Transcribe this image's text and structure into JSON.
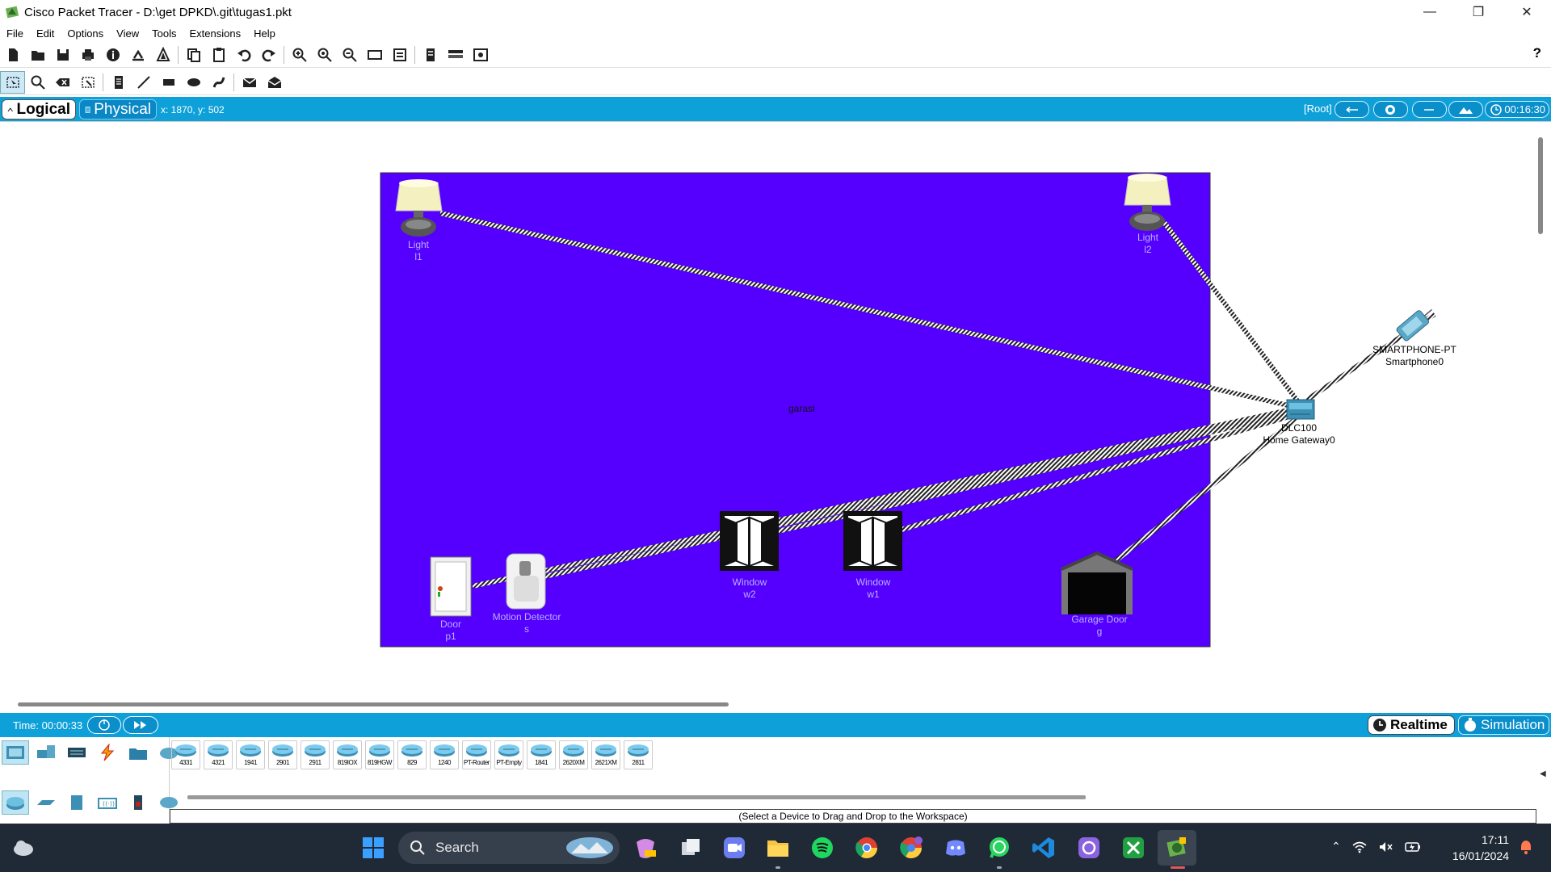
{
  "window": {
    "title": "Cisco Packet Tracer - D:\\get DPKD\\.git\\tugas1.pkt",
    "controls": [
      "minimize",
      "restore",
      "close"
    ]
  },
  "menu": [
    "File",
    "Edit",
    "Options",
    "View",
    "Tools",
    "Extensions",
    "Help"
  ],
  "toolbar": {
    "main_icons": [
      "new-file-icon",
      "open-folder-icon",
      "save-icon",
      "print-icon",
      "info-icon",
      "activity-wizard-icon",
      "network-info-icon",
      "copy-icon",
      "paste-icon",
      "undo-icon",
      "redo-icon",
      "zoom-in-icon",
      "zoom-reset-icon",
      "zoom-out-icon",
      "drawing-palette-icon",
      "custom-device-dialog-icon",
      "viewport-icon",
      "cluster-icon",
      "pdu-list-icon"
    ],
    "help_label": "?",
    "edit_icons": [
      "select-icon",
      "inspect-icon",
      "delete-icon",
      "resize-icon",
      "note-icon",
      "line-icon",
      "rectangle-icon",
      "ellipse-icon",
      "freeform-icon",
      "simple-pdu-icon",
      "complex-pdu-icon"
    ]
  },
  "modes": {
    "logical": "Logical",
    "physical": "Physical",
    "coordinates": "x: 1870, y: 502",
    "root": "[Root]",
    "clock": "00:16:30"
  },
  "workspace": {
    "container_label": "garasi",
    "container_color": "#5500ff",
    "devices": [
      {
        "id": "light-l1",
        "type": "Light",
        "name": "l1"
      },
      {
        "id": "light-l2",
        "type": "Light",
        "name": "l2"
      },
      {
        "id": "smartphone",
        "type": "SMARTPHONE-PT",
        "name": "Smartphone0"
      },
      {
        "id": "gateway",
        "type": "DLC100",
        "name": "Home Gateway0"
      },
      {
        "id": "window-w2",
        "type": "Window",
        "name": "w2"
      },
      {
        "id": "window-w1",
        "type": "Window",
        "name": "w1"
      },
      {
        "id": "door-p1",
        "type": "Door",
        "name": "p1"
      },
      {
        "id": "motion-s",
        "type": "Motion Detector",
        "name": "s"
      },
      {
        "id": "garage-g",
        "type": "Garage Door",
        "name": "g"
      }
    ]
  },
  "timebar": {
    "time": "Time: 00:00:33",
    "realtime": "Realtime",
    "simulation": "Simulation"
  },
  "palette": {
    "categories_top": [
      "network-devices-icon",
      "end-devices-icon",
      "components-icon",
      "connections-icon",
      "miscellaneous-icon",
      "multiuser-icon"
    ],
    "categories_bottom": [
      "routers-icon",
      "switches-icon",
      "hubs-icon",
      "wireless-devices-icon",
      "security-icon",
      "wan-emulation-icon"
    ],
    "models": [
      "4331",
      "4321",
      "1941",
      "2901",
      "2911",
      "819IOX",
      "819HGW",
      "829",
      "1240",
      "PT-Router",
      "PT-Empty",
      "1841",
      "2620XM",
      "2621XM",
      "2811"
    ],
    "status": "(Select a Device to Drag and Drop to the Workspace)"
  },
  "taskbar": {
    "search_placeholder": "Search",
    "apps": [
      "start-icon",
      "search-icon",
      "copilot-icon",
      "task-view-icon",
      "zoom-icon",
      "file-explorer-icon",
      "spotify-icon",
      "chrome-icon",
      "chrome-profile-icon",
      "discord-icon",
      "whatsapp-icon",
      "vscode-icon",
      "proton-icon",
      "xbox-icon",
      "packet-tracer-icon"
    ],
    "time": "17:11",
    "date": "16/01/2024"
  }
}
